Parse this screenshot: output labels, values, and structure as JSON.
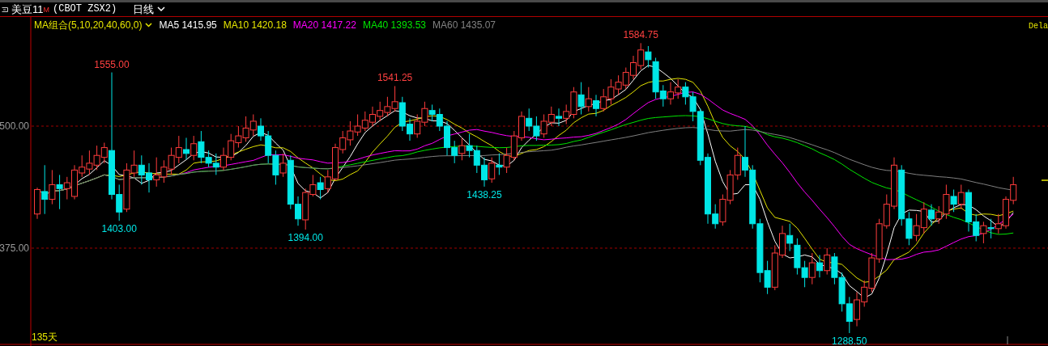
{
  "header": {
    "symbol": "美豆11",
    "marker": "M",
    "code": "(CBOT ZSX2)",
    "period": "日线"
  },
  "legend": {
    "group": "MA组合(5,10,20,40,60,0)",
    "items": [
      {
        "label": "MA5",
        "value": "1415.95",
        "color": "#ffffff"
      },
      {
        "label": "MA10",
        "value": "1420.18",
        "color": "#e6e600"
      },
      {
        "label": "MA20",
        "value": "1417.22",
        "color": "#ff00ff"
      },
      {
        "label": "MA40",
        "value": "1393.53",
        "color": "#00e600"
      },
      {
        "label": "MA60",
        "value": "1435.07",
        "color": "#808080"
      }
    ]
  },
  "status": "Dela",
  "chart": {
    "y_labels": [
      "500.00",
      "375.00"
    ],
    "price_labels": [
      {
        "text": "1555.00",
        "kind": "high"
      },
      {
        "text": "1403.00",
        "kind": "low"
      },
      {
        "text": "1394.00",
        "kind": "low"
      },
      {
        "text": "1541.25",
        "kind": "high"
      },
      {
        "text": "1438.25",
        "kind": "low"
      },
      {
        "text": "1584.75",
        "kind": "high"
      },
      {
        "text": "1288.50",
        "kind": "low"
      }
    ],
    "day_count": "135天"
  }
}
